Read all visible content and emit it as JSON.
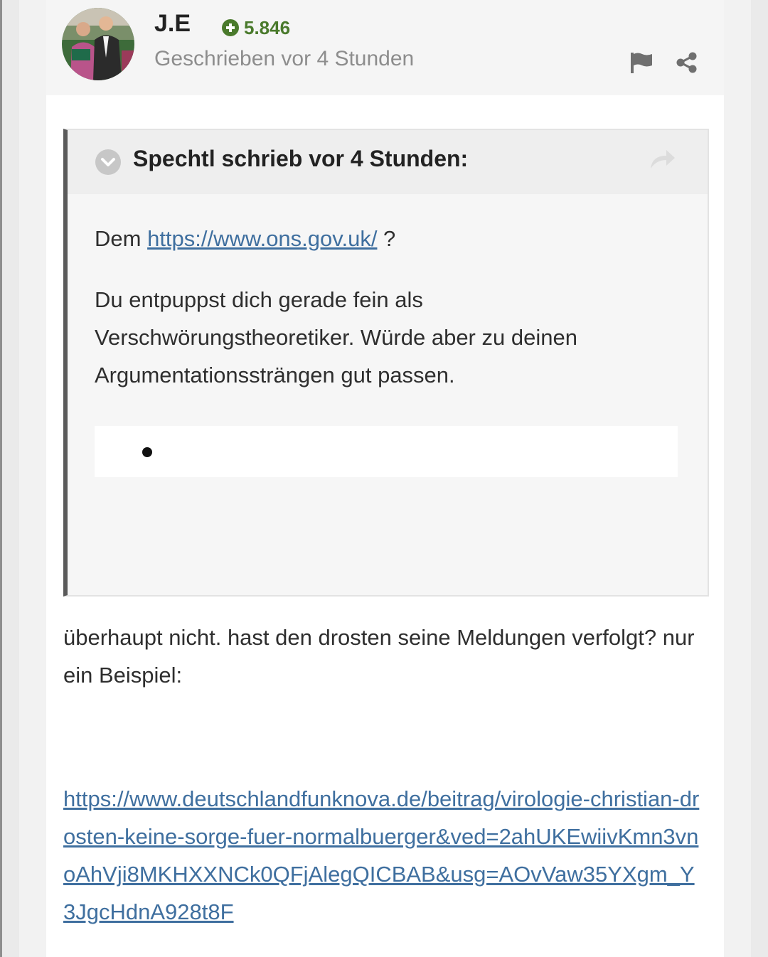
{
  "post": {
    "author": "J.E",
    "reputation": "5.846",
    "timestamp": "Geschrieben vor 4 Stunden",
    "colors": {
      "accent": "#4a7a2c",
      "link": "#3f6f9f",
      "quote_border": "#5a5a5a"
    },
    "icons": [
      "plus-circle-icon",
      "flag-icon",
      "share-icon"
    ]
  },
  "quote": {
    "title": "Spechtl schrieb vor 4 Stunden:",
    "icons": [
      "collapse-icon",
      "goto-quoted-post-icon"
    ],
    "line1_prefix": "Dem",
    "line1_link": "https://www.ons.gov.uk/",
    "line1_suffix": " ?",
    "paragraph2": "Du entpuppst dich gerade fein als Verschwörungstheoretiker. Würde aber zu deinen Argumentationssträngen gut passen."
  },
  "reply": {
    "text": "überhaupt nicht. hast den drosten seine Meldungen verfolgt? nur ein Beispiel:",
    "link": "https://www.deutschlandfunknova.de/beitrag/virologie-christian-drosten-keine-sorge-fuer-normalbuerger&ved=2ahUKEwiivKmn3vnoAhVji8MKHXXNCk0QFjAlegQICBAB&usg=AOvVaw35YXgm_Y3JgcHdnA928t8F"
  }
}
